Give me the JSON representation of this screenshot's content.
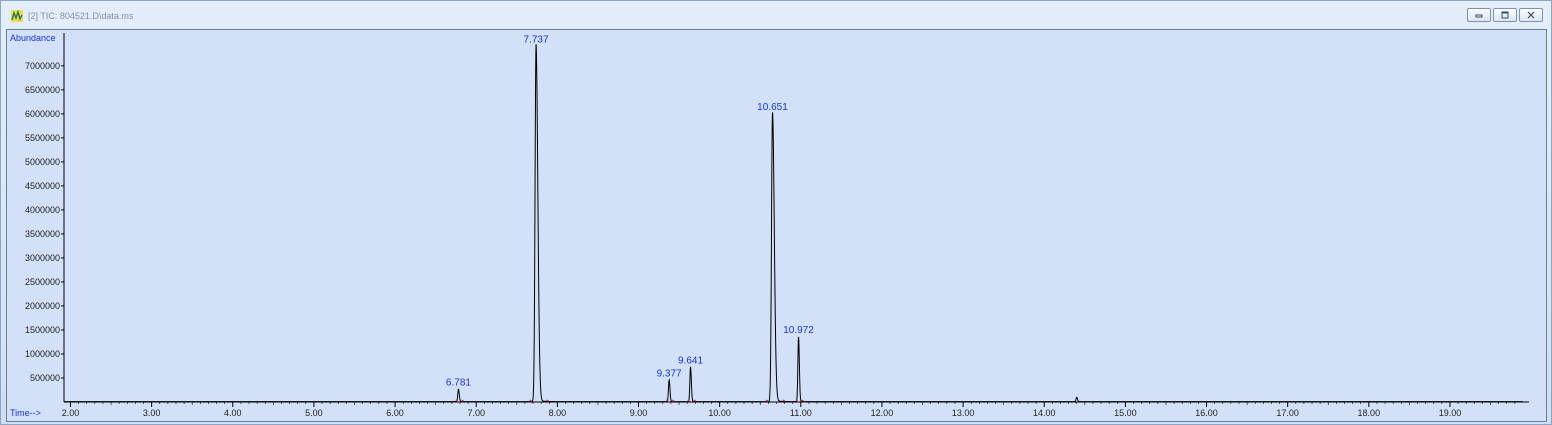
{
  "window": {
    "title": "[2] TIC: 804521.D\\data.ms",
    "app_icon": "chromatogram-app-icon",
    "buttons": [
      "minimize-icon",
      "restore-icon",
      "close-icon"
    ]
  },
  "colors": {
    "plot_background": "#d3e1f8",
    "trace": "#000000",
    "peak_labels": "#1a35c8",
    "baseline_markers": "#e0303a"
  },
  "chart_data": {
    "type": "line",
    "title": "",
    "ylabel": "Abundance",
    "xlabel": "Time-->",
    "xlim": [
      1.92,
      19.9
    ],
    "ylim": [
      0,
      7600000
    ],
    "grid": false,
    "x_ticks": [
      2.0,
      3.0,
      4.0,
      5.0,
      6.0,
      7.0,
      8.0,
      9.0,
      10.0,
      11.0,
      12.0,
      13.0,
      14.0,
      15.0,
      16.0,
      17.0,
      18.0,
      19.0
    ],
    "x_tick_labels": [
      "2.00",
      "3.00",
      "4.00",
      "5.00",
      "6.00",
      "7.00",
      "8.00",
      "9.00",
      "10.00",
      "11.00",
      "12.00",
      "13.00",
      "14.00",
      "15.00",
      "16.00",
      "17.00",
      "18.00",
      "19.00"
    ],
    "y_ticks": [
      500000,
      1000000,
      1500000,
      2000000,
      2500000,
      3000000,
      3500000,
      4000000,
      4500000,
      5000000,
      5500000,
      6000000,
      6500000,
      7000000
    ],
    "y_tick_labels": [
      "500000",
      "1000000",
      "1500000",
      "2000000",
      "2500000",
      "3000000",
      "3500000",
      "4000000",
      "4500000",
      "5000000",
      "5500000",
      "6000000",
      "6500000",
      "7000000"
    ],
    "peaks": [
      {
        "rt": 6.781,
        "label": "6.781",
        "height": 260000
      },
      {
        "rt": 7.737,
        "label": "7.737",
        "height": 7400000
      },
      {
        "rt": 9.377,
        "label": "9.377",
        "height": 450000
      },
      {
        "rt": 9.641,
        "label": "9.641",
        "height": 720000
      },
      {
        "rt": 10.651,
        "label": "10.651",
        "height": 6000000
      },
      {
        "rt": 10.972,
        "label": "10.972",
        "height": 1350000
      }
    ],
    "minor_features": [
      {
        "rt": 14.4,
        "height": 90000
      }
    ]
  }
}
